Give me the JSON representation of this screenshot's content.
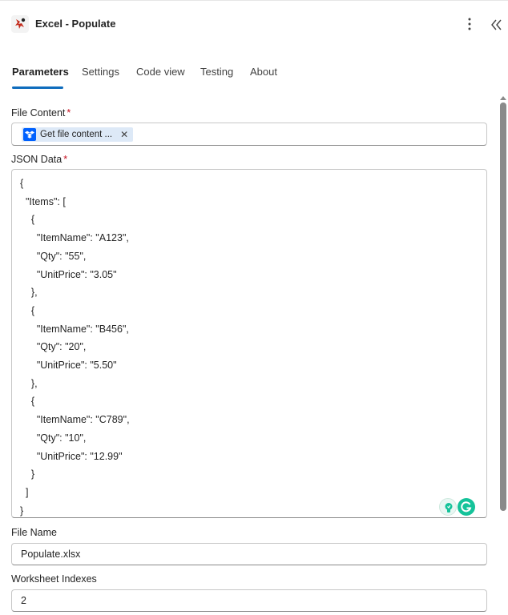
{
  "header": {
    "title": "Excel - Populate",
    "app_icon": "app-logo-icon",
    "more_icon": "more-vertical-icon",
    "collapse_icon": "double-chevron-left-icon"
  },
  "tabs": [
    {
      "label": "Parameters",
      "active": true
    },
    {
      "label": "Settings"
    },
    {
      "label": "Code view"
    },
    {
      "label": "Testing"
    },
    {
      "label": "About"
    }
  ],
  "colors": {
    "accent": "#0f6cbd",
    "required": "#c50f1f",
    "token_bg": "#dde9f7",
    "dropbox": "#0061fe",
    "grammarly": "#15c39a"
  },
  "fields": {
    "file_content": {
      "label": "File Content",
      "required_mark": "*",
      "token": {
        "label": "Get file content ...",
        "icon": "dropbox-icon",
        "close": "✕"
      }
    },
    "json_data": {
      "label": "JSON Data",
      "required_mark": "*",
      "lines": [
        "{",
        "  \"Items\": [",
        "    {",
        "      \"ItemName\": \"A123\",",
        "      \"Qty\": \"55\",",
        "      \"UnitPrice\": \"3.05\"",
        "    },",
        "    {",
        "      \"ItemName\": \"B456\",",
        "      \"Qty\": \"20\",",
        "      \"UnitPrice\": \"5.50\"",
        "    },",
        "    {",
        "      \"ItemName\": \"C789\",",
        "      \"Qty\": \"10\",",
        "      \"UnitPrice\": \"12.99\"",
        "    }",
        "  ]",
        "}"
      ]
    },
    "file_name": {
      "label": "File Name",
      "value": "Populate.xlsx"
    },
    "worksheet_indexes": {
      "label": "Worksheet Indexes",
      "value": "2"
    }
  }
}
